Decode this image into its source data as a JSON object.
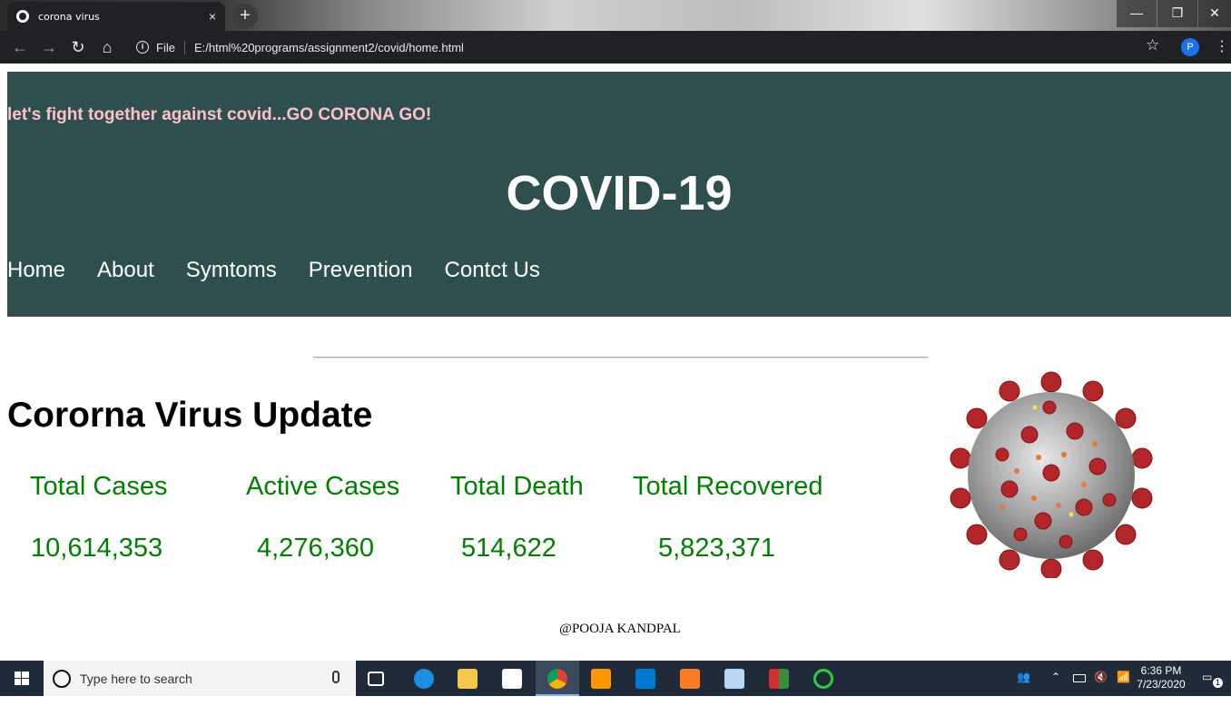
{
  "browser": {
    "tab_title": "corona virus",
    "tab_close": "×",
    "new_tab": "+",
    "url_scheme_label": "File",
    "url": "E:/html%20programs/assignment2/covid/home.html",
    "profile_initial": "P",
    "window_controls": {
      "minimize": "—",
      "maximize": "❐",
      "close": "✕"
    }
  },
  "page": {
    "tagline": "let's fight together against covid...GO CORONA GO!",
    "heading": "COVID-19",
    "nav": [
      "Home",
      "About",
      "Symtoms",
      "Prevention",
      "Contct Us"
    ],
    "update_heading": "Cororna Virus Update",
    "stats": [
      {
        "label": "Total Cases",
        "value": "10,614,353"
      },
      {
        "label": "Active Cases",
        "value": "4,276,360"
      },
      {
        "label": "Total Death",
        "value": "514,622"
      },
      {
        "label": "Total Recovered",
        "value": "5,823,371"
      }
    ],
    "footer": "@POOJA KANDPAL"
  },
  "taskbar": {
    "search_placeholder": "Type here to search",
    "time": "6:36 PM",
    "date": "7/23/2020",
    "notification_count": "1"
  },
  "colors": {
    "header_bg": "#2f4f4f",
    "tagline": "#ffc0cb",
    "stat_text": "#008000"
  }
}
